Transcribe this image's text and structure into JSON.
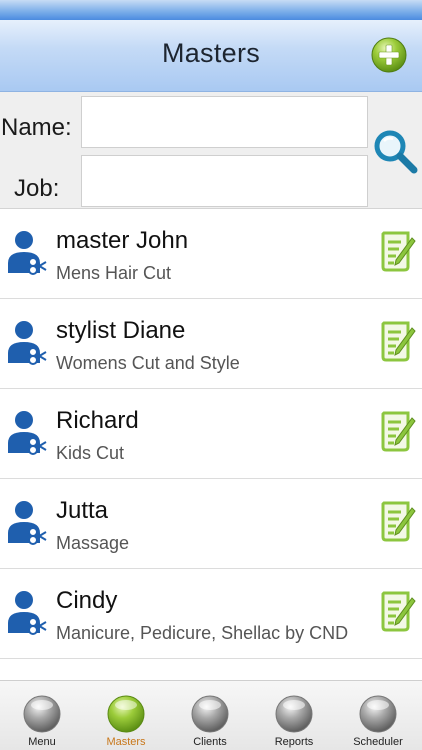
{
  "header": {
    "title": "Masters",
    "add_icon": "plus-circle-icon"
  },
  "search": {
    "name_label": "Name:",
    "job_label": "Job:",
    "name_value": "",
    "job_value": "",
    "search_icon": "magnifier-icon"
  },
  "masters": [
    {
      "name": "master John",
      "job": "Mens Hair Cut"
    },
    {
      "name": "stylist Diane",
      "job": "Womens Cut and Style"
    },
    {
      "name": "Richard",
      "job": "Kids Cut"
    },
    {
      "name": "Jutta",
      "job": "Massage"
    },
    {
      "name": "Cindy",
      "job": "Manicure, Pedicure, Shellac by CND"
    }
  ],
  "tabs": [
    {
      "label": "Menu",
      "active": false
    },
    {
      "label": "Masters",
      "active": true
    },
    {
      "label": "Clients",
      "active": false
    },
    {
      "label": "Reports",
      "active": false
    },
    {
      "label": "Scheduler",
      "active": false
    }
  ],
  "colors": {
    "header_blue": "#a9c9f2",
    "accent_green": "#8cc63f",
    "avatar_blue": "#1f5fae",
    "active_tab": "#c8771a"
  }
}
